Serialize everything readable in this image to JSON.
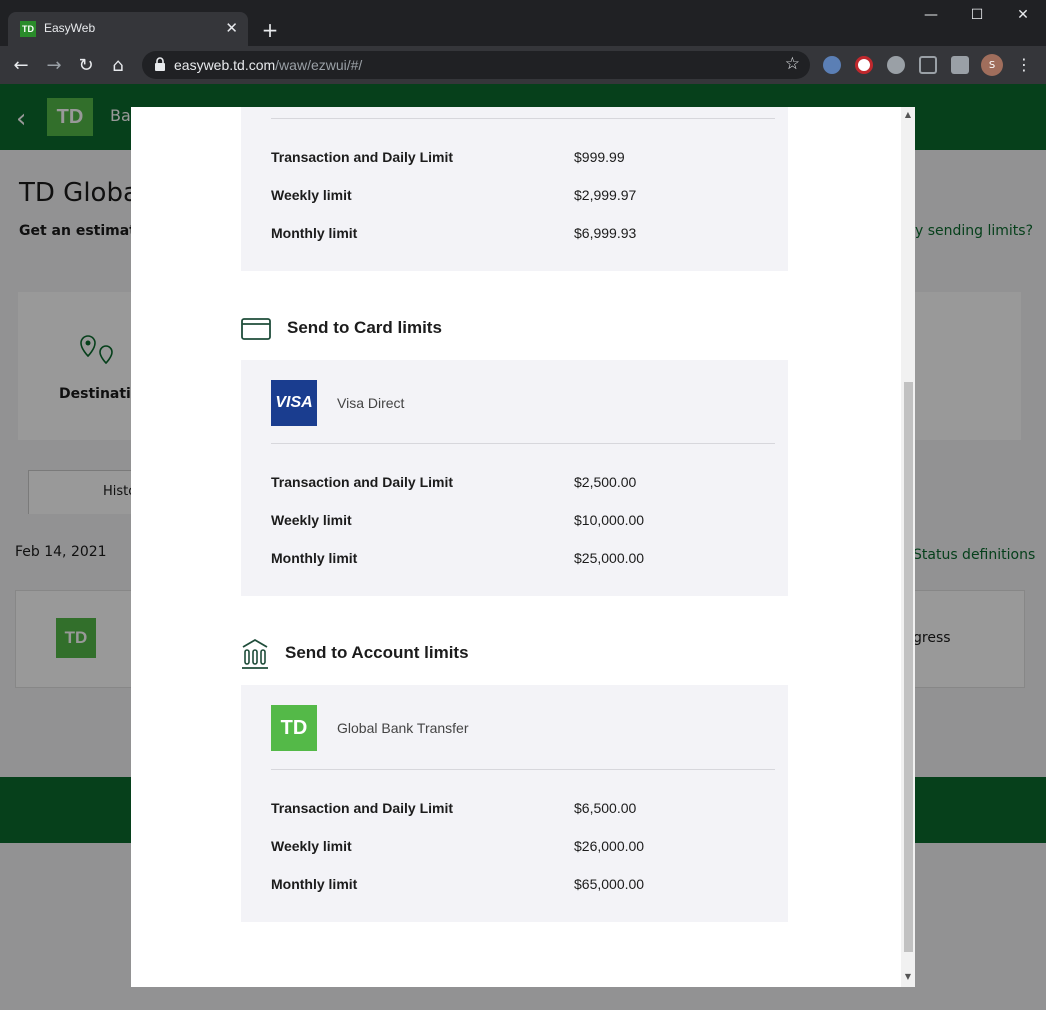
{
  "browser": {
    "tab_title": "EasyWeb",
    "favicon_text": "TD",
    "url_host": "easyweb.td.com",
    "url_path": "/waw/ezwui/#/",
    "avatar_initial": "S"
  },
  "background_page": {
    "header_label": "Ba",
    "title": "TD Globa",
    "subtitle": "Get an estimate",
    "sending_limits_link": "y sending limits?",
    "destination_label": "Destination",
    "history_tab": "Histo",
    "date": "Feb 14, 2021",
    "status_definitions_link": "Status definitions",
    "progress_text": "gress",
    "logo_text": "TD"
  },
  "modal": {
    "top_section": {
      "rows": [
        {
          "label": "Transaction and Daily Limit",
          "value": "$999.99"
        },
        {
          "label": "Weekly limit",
          "value": "$2,999.97"
        },
        {
          "label": "Monthly limit",
          "value": "$6,999.93"
        }
      ]
    },
    "card_section": {
      "title": "Send to Card limits",
      "provider_logo": "VISA",
      "provider_name": "Visa Direct",
      "rows": [
        {
          "label": "Transaction and Daily Limit",
          "value": "$2,500.00"
        },
        {
          "label": "Weekly limit",
          "value": "$10,000.00"
        },
        {
          "label": "Monthly limit",
          "value": "$25,000.00"
        }
      ]
    },
    "account_section": {
      "title": "Send to Account limits",
      "provider_logo": "TD",
      "provider_name": "Global Bank Transfer",
      "rows": [
        {
          "label": "Transaction and Daily Limit",
          "value": "$6,500.00"
        },
        {
          "label": "Weekly limit",
          "value": "$26,000.00"
        },
        {
          "label": "Monthly limit",
          "value": "$65,000.00"
        }
      ]
    }
  },
  "colors": {
    "td_green": "#54b948",
    "td_dark_green": "#0a6b2e",
    "visa_blue": "#1a3d8f",
    "panel_bg": "#f3f3f7"
  },
  "icons": {
    "card_section": "credit-card-icon",
    "account_section": "bank-icon",
    "destination": "map-pin-icon"
  }
}
